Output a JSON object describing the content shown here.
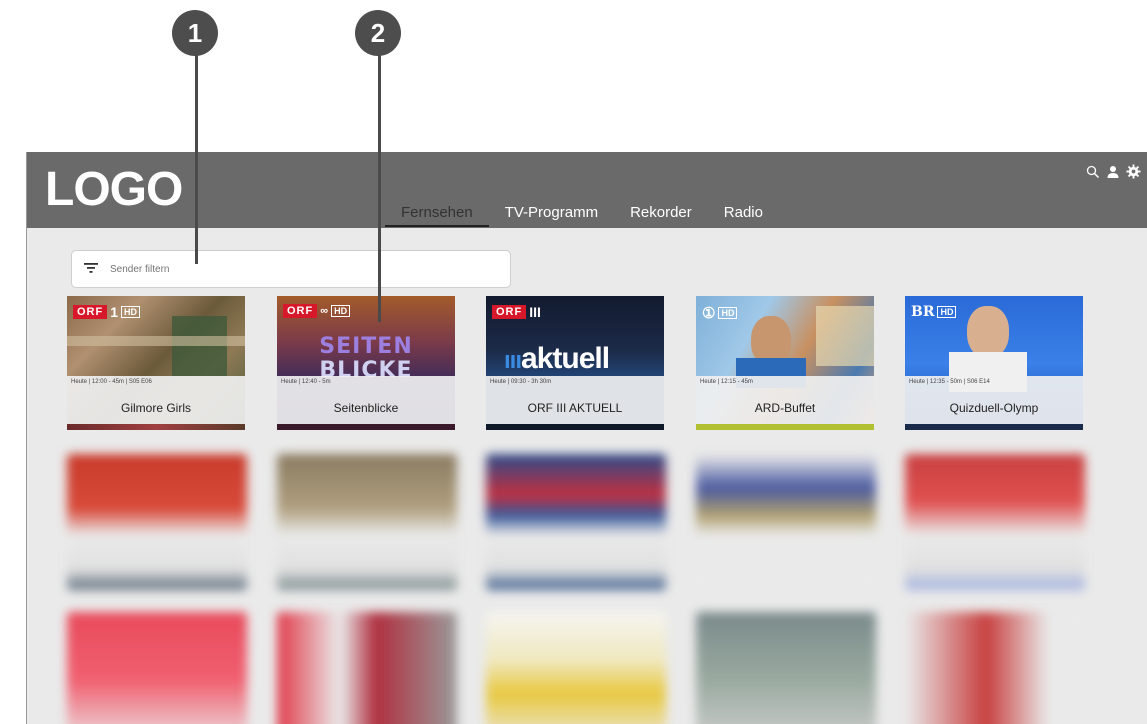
{
  "callouts": [
    "1",
    "2"
  ],
  "app": {
    "logo": "LOGO",
    "nav": {
      "tabs": [
        "Fernsehen",
        "TV-Programm",
        "Rekorder",
        "Radio"
      ],
      "active": "Fernsehen"
    },
    "header_icons": [
      "search-icon",
      "user-icon",
      "gear-icon"
    ],
    "filter": {
      "placeholder": "Sender filtern",
      "icon": "filter-icon"
    },
    "channels": [
      {
        "logo_text": "ORF",
        "logo_mark": "1",
        "hd": "HD",
        "meta": "Heute | 12:00 - 45m | S05 E06",
        "title": "Gilmore Girls"
      },
      {
        "logo_text": "ORF",
        "logo_mark": "∞",
        "hd": "HD",
        "meta": "Heute | 12:40 - 5m",
        "title": "Seitenblicke",
        "thumb_text_1": "SEITEN",
        "thumb_text_2": "BLICKE"
      },
      {
        "logo_text": "ORF",
        "logo_mark": "III",
        "hd": "",
        "meta": "Heute | 09:30 - 3h 30m",
        "title": "ORF III AKTUELL",
        "thumb_text_1": "ııı",
        "thumb_text_2": "aktuell"
      },
      {
        "logo_text": "",
        "logo_mark": "①",
        "hd": "HD",
        "meta": "Heute | 12:15 - 45m",
        "title": "ARD-Buffet"
      },
      {
        "logo_text": "",
        "logo_mark": "BR",
        "hd": "HD",
        "meta": "Heute | 12:35 - 50m | S06 E14",
        "title": "Quizduell-Olymp"
      }
    ]
  }
}
